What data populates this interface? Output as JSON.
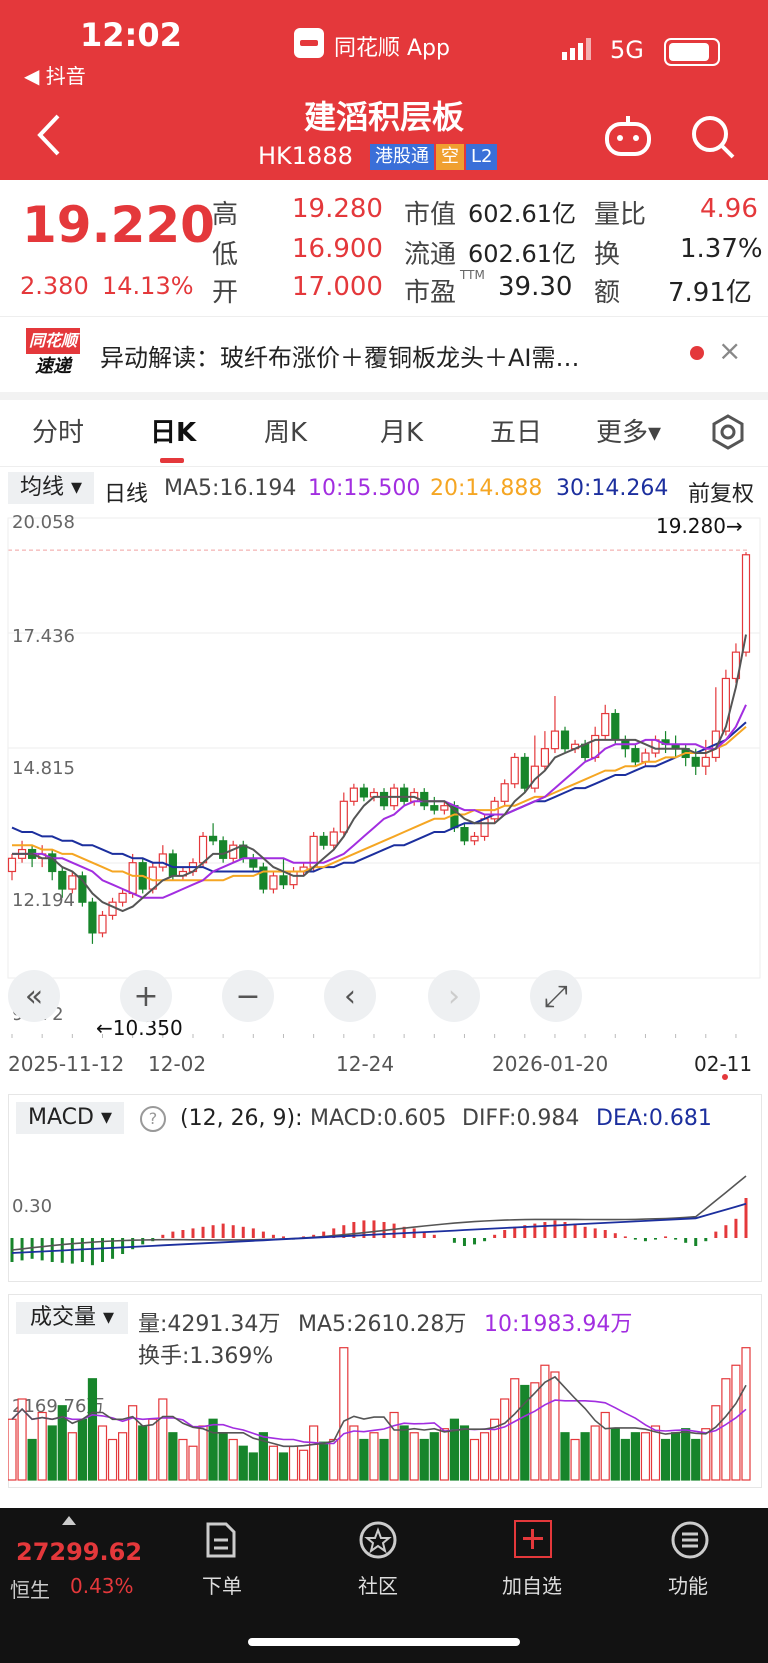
{
  "status_bar": {
    "time": "12:02",
    "back_app": "◀ 抖音",
    "app_title": "同花顺 App",
    "network": "5G"
  },
  "header": {
    "title": "建滔积层板",
    "code": "HK1888",
    "tags": [
      "港股通",
      "空",
      "L2"
    ]
  },
  "quote": {
    "price": "19.220",
    "change": "2.380",
    "change_pct": "14.13%",
    "rows": [
      [
        {
          "label": "高",
          "value": "19.280"
        },
        {
          "label": "市值",
          "value": "602.61亿"
        },
        {
          "label": "量比",
          "value": "4.96"
        }
      ],
      [
        {
          "label": "低",
          "value": "16.900"
        },
        {
          "label": "流通",
          "value": "602.61亿"
        },
        {
          "label": "换",
          "value": "1.37%"
        }
      ],
      [
        {
          "label": "开",
          "value": "17.000"
        },
        {
          "label": "市盈",
          "sup": "TTM",
          "value": "39.30"
        },
        {
          "label": "额",
          "value": "7.91亿"
        }
      ]
    ]
  },
  "news": {
    "logo_top": "同花顺",
    "logo_bottom": "速递",
    "text": "异动解读：玻纤布涨价＋覆铜板龙头＋AI需…",
    "close": "×"
  },
  "tabs": [
    "分时",
    "日K",
    "周K",
    "月K",
    "五日",
    "更多▾"
  ],
  "active_tab": 1,
  "ma_bar": {
    "selector": "均线 ▾",
    "period": "日线",
    "ma5": "MA5:16.194",
    "ma10": "10:15.500",
    "ma20": "20:14.888",
    "ma30": "30:14.264",
    "adjust": "前复权"
  },
  "colors": {
    "up": "#e4383b",
    "down": "#17852b",
    "ma5": "#555555",
    "ma10": "#a22ee0",
    "ma20": "#f5a623",
    "ma30": "#1c2f9e"
  },
  "chart_data": {
    "type": "candlestick",
    "y_ticks": [
      "20.058",
      "17.436",
      "14.815",
      "12.194",
      "9.572"
    ],
    "ylim": [
      9.572,
      20.058
    ],
    "x_ticks": [
      "2025-11-12",
      "12-02",
      "12-24",
      "2026-01-20",
      "02-11"
    ],
    "high_marker": "19.280→",
    "low_marker": "←10.350",
    "candles": [
      [
        12.0,
        12.3,
        11.8,
        12.4
      ],
      [
        12.3,
        12.5,
        12.2,
        12.7
      ],
      [
        12.5,
        12.3,
        12.1,
        12.6
      ],
      [
        12.3,
        12.4,
        12.1,
        12.6
      ],
      [
        12.4,
        12.0,
        11.8,
        12.5
      ],
      [
        12.0,
        11.6,
        11.4,
        12.1
      ],
      [
        11.6,
        11.9,
        11.5,
        12.0
      ],
      [
        11.9,
        11.3,
        11.2,
        12.0
      ],
      [
        11.3,
        10.6,
        10.35,
        11.4
      ],
      [
        10.6,
        11.0,
        10.5,
        11.1
      ],
      [
        11.0,
        11.3,
        10.9,
        11.4
      ],
      [
        11.3,
        11.5,
        11.2,
        11.6
      ],
      [
        11.5,
        12.2,
        11.4,
        12.4
      ],
      [
        12.2,
        11.6,
        11.5,
        12.3
      ],
      [
        11.6,
        12.1,
        11.5,
        12.2
      ],
      [
        12.1,
        12.4,
        12.0,
        12.6
      ],
      [
        12.4,
        11.9,
        11.8,
        12.5
      ],
      [
        11.9,
        12.0,
        11.8,
        12.1
      ],
      [
        12.0,
        12.2,
        11.9,
        12.3
      ],
      [
        12.2,
        12.8,
        12.1,
        12.9
      ],
      [
        12.8,
        12.7,
        12.6,
        13.1
      ],
      [
        12.7,
        12.3,
        12.2,
        12.8
      ],
      [
        12.3,
        12.6,
        12.2,
        12.7
      ],
      [
        12.6,
        12.3,
        12.2,
        12.7
      ],
      [
        12.3,
        12.1,
        12.0,
        12.4
      ],
      [
        12.1,
        11.6,
        11.5,
        12.2
      ],
      [
        11.6,
        11.9,
        11.5,
        12.0
      ],
      [
        11.9,
        11.7,
        11.6,
        12.3
      ],
      [
        11.7,
        12.0,
        11.6,
        12.1
      ],
      [
        12.0,
        12.1,
        11.9,
        12.2
      ],
      [
        12.1,
        12.8,
        12.0,
        12.9
      ],
      [
        12.8,
        12.6,
        12.5,
        12.9
      ],
      [
        12.6,
        12.9,
        12.5,
        13.0
      ],
      [
        12.9,
        13.6,
        12.8,
        13.8
      ],
      [
        13.6,
        13.9,
        13.5,
        14.0
      ],
      [
        13.9,
        13.7,
        13.6,
        14.0
      ],
      [
        13.7,
        13.8,
        13.6,
        13.9
      ],
      [
        13.8,
        13.5,
        13.4,
        13.9
      ],
      [
        13.5,
        13.9,
        13.4,
        14.0
      ],
      [
        13.9,
        13.6,
        13.5,
        14.0
      ],
      [
        13.6,
        13.8,
        13.5,
        13.9
      ],
      [
        13.8,
        13.5,
        13.4,
        13.9
      ],
      [
        13.5,
        13.4,
        13.3,
        13.7
      ],
      [
        13.4,
        13.5,
        13.3,
        13.6
      ],
      [
        13.5,
        13.0,
        12.9,
        13.6
      ],
      [
        13.0,
        12.7,
        12.6,
        13.1
      ],
      [
        12.7,
        12.8,
        12.6,
        12.9
      ],
      [
        12.8,
        13.2,
        12.7,
        13.3
      ],
      [
        13.2,
        13.6,
        13.1,
        13.7
      ],
      [
        13.6,
        14.0,
        13.5,
        14.1
      ],
      [
        14.0,
        14.6,
        13.9,
        14.7
      ],
      [
        14.6,
        13.9,
        13.8,
        14.7
      ],
      [
        13.9,
        14.4,
        13.8,
        15.1
      ],
      [
        14.4,
        14.8,
        14.3,
        15.2
      ],
      [
        14.8,
        15.2,
        14.7,
        16.0
      ],
      [
        15.2,
        14.8,
        14.7,
        15.3
      ],
      [
        14.8,
        14.9,
        14.7,
        15.0
      ],
      [
        14.9,
        14.6,
        14.5,
        15.0
      ],
      [
        14.6,
        15.1,
        14.5,
        15.3
      ],
      [
        15.1,
        15.6,
        15.0,
        15.8
      ],
      [
        15.6,
        15.0,
        14.9,
        15.7
      ],
      [
        15.0,
        14.8,
        14.6,
        15.1
      ],
      [
        14.8,
        14.5,
        14.4,
        14.9
      ],
      [
        14.5,
        14.7,
        14.4,
        14.8
      ],
      [
        14.7,
        15.0,
        14.6,
        15.1
      ],
      [
        15.0,
        14.9,
        14.7,
        15.2
      ],
      [
        14.9,
        14.8,
        14.6,
        15.1
      ],
      [
        14.8,
        14.6,
        14.4,
        14.9
      ],
      [
        14.6,
        14.4,
        14.2,
        14.8
      ],
      [
        14.4,
        14.6,
        14.2,
        15.0
      ],
      [
        14.6,
        15.2,
        14.5,
        16.2
      ],
      [
        15.2,
        16.4,
        15.1,
        16.6
      ],
      [
        16.4,
        17.0,
        16.3,
        17.2
      ],
      [
        17.0,
        19.22,
        16.9,
        19.28
      ]
    ],
    "ma5": [
      12.4,
      12.4,
      12.4,
      12.3,
      12.3,
      12.1,
      12.0,
      11.8,
      11.5,
      11.3,
      11.2,
      11.1,
      11.2,
      11.4,
      11.6,
      11.8,
      11.9,
      11.9,
      12.0,
      12.2,
      12.4,
      12.4,
      12.5,
      12.6,
      12.5,
      12.3,
      12.1,
      12.0,
      11.9,
      11.9,
      12.1,
      12.3,
      12.5,
      12.8,
      13.2,
      13.5,
      13.7,
      13.7,
      13.7,
      13.7,
      13.7,
      13.6,
      13.6,
      13.6,
      13.4,
      13.2,
      13.1,
      13.1,
      13.1,
      13.3,
      13.6,
      13.8,
      14.1,
      14.3,
      14.6,
      14.7,
      14.8,
      14.9,
      15.0,
      15.0,
      15.0,
      15.0,
      15.0,
      14.9,
      14.8,
      14.8,
      14.8,
      14.8,
      14.7,
      14.7,
      14.8,
      15.3,
      16.2,
      17.4
    ],
    "ma10": [
      12.4,
      12.4,
      12.4,
      12.4,
      12.3,
      12.3,
      12.2,
      12.1,
      12.0,
      11.8,
      11.7,
      11.6,
      11.5,
      11.4,
      11.4,
      11.4,
      11.5,
      11.6,
      11.7,
      11.8,
      12.0,
      12.1,
      12.2,
      12.3,
      12.3,
      12.3,
      12.3,
      12.3,
      12.2,
      12.2,
      12.2,
      12.2,
      12.3,
      12.4,
      12.6,
      12.8,
      13.0,
      13.2,
      13.3,
      13.5,
      13.6,
      13.6,
      13.6,
      13.6,
      13.5,
      13.4,
      13.4,
      13.3,
      13.3,
      13.3,
      13.4,
      13.5,
      13.6,
      13.7,
      13.9,
      14.1,
      14.3,
      14.5,
      14.6,
      14.8,
      14.9,
      14.9,
      14.9,
      15.0,
      15.0,
      14.9,
      14.9,
      14.9,
      14.9,
      14.8,
      14.8,
      15.0,
      15.3,
      15.8
    ],
    "ma20": [
      12.6,
      12.6,
      12.6,
      12.5,
      12.5,
      12.4,
      12.4,
      12.3,
      12.2,
      12.1,
      12.0,
      12.0,
      11.9,
      11.9,
      11.8,
      11.8,
      11.8,
      11.8,
      11.8,
      11.8,
      11.8,
      11.8,
      11.9,
      11.9,
      11.9,
      12.0,
      12.0,
      12.0,
      12.0,
      12.0,
      12.1,
      12.1,
      12.2,
      12.3,
      12.4,
      12.5,
      12.6,
      12.7,
      12.8,
      12.9,
      13.0,
      13.1,
      13.2,
      13.2,
      13.3,
      13.3,
      13.4,
      13.4,
      13.4,
      13.5,
      13.5,
      13.6,
      13.7,
      13.7,
      13.8,
      13.9,
      14.0,
      14.1,
      14.2,
      14.3,
      14.3,
      14.4,
      14.4,
      14.5,
      14.5,
      14.6,
      14.6,
      14.7,
      14.7,
      14.7,
      14.8,
      14.9,
      15.1,
      15.3
    ],
    "ma30": [
      13.0,
      12.9,
      12.9,
      12.8,
      12.8,
      12.7,
      12.7,
      12.6,
      12.6,
      12.5,
      12.4,
      12.4,
      12.3,
      12.3,
      12.2,
      12.2,
      12.1,
      12.1,
      12.1,
      12.1,
      12.0,
      12.0,
      12.0,
      12.0,
      12.0,
      12.0,
      12.0,
      12.0,
      12.0,
      12.0,
      12.0,
      12.1,
      12.1,
      12.2,
      12.2,
      12.3,
      12.4,
      12.5,
      12.6,
      12.6,
      12.7,
      12.8,
      12.9,
      12.9,
      13.0,
      13.1,
      13.1,
      13.2,
      13.3,
      13.3,
      13.4,
      13.5,
      13.6,
      13.6,
      13.7,
      13.8,
      13.9,
      13.9,
      14.0,
      14.1,
      14.2,
      14.2,
      14.3,
      14.4,
      14.4,
      14.5,
      14.6,
      14.7,
      14.7,
      14.8,
      14.9,
      15.0,
      15.2,
      15.4
    ]
  },
  "macd": {
    "selector": "MACD ▾",
    "help": "?",
    "params": "(12, 26, 9):",
    "macd": "MACD:0.605",
    "diff": "DIFF:0.984",
    "dea": "DEA:0.681",
    "y_tick": "0.30"
  },
  "volume": {
    "selector": "成交量 ▾",
    "vol": "量:4291.34万",
    "ma5": "MA5:2610.28万",
    "ma10": "10:1983.94万",
    "turnover": "换手:1.369%",
    "y_tick": "2169.76万"
  },
  "controls": {
    "first": "«",
    "zoom_in": "+",
    "zoom_out": "−",
    "prev": "‹",
    "next": "›",
    "fullscreen": "⤢"
  },
  "bottom": {
    "index_value": "27299.62",
    "index_name": "恒生",
    "index_pct": "0.43%",
    "items": [
      "下单",
      "社区",
      "加自选",
      "功能"
    ]
  }
}
